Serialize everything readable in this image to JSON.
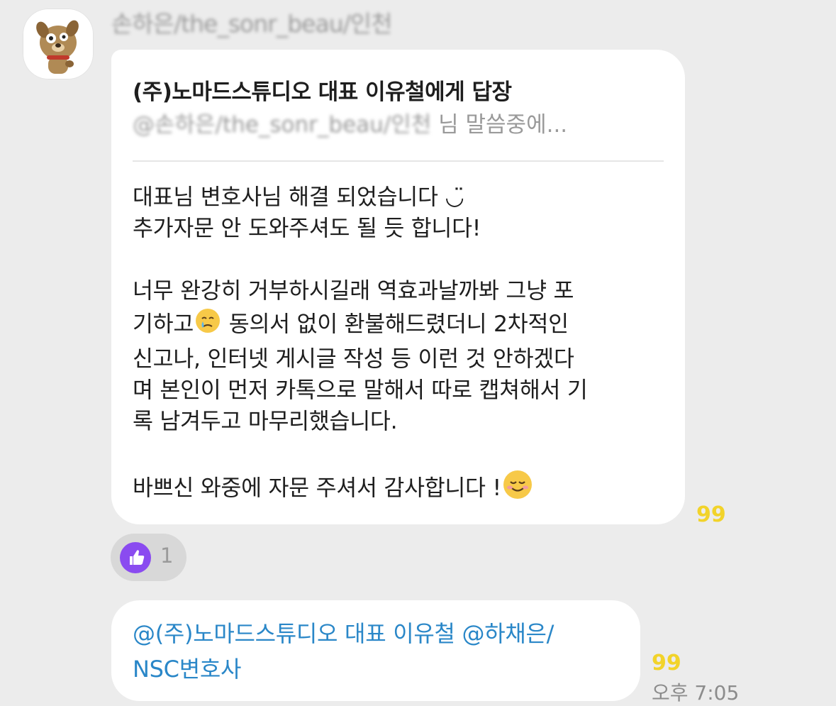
{
  "message1": {
    "sender_name": "손하은/the_sonr_beau/인천",
    "reply_header": {
      "title": "(주)노마드스튜디오 대표 이유철에게 답장",
      "quoted_user": "@손하은/the_sonr_beau/인천",
      "quoted_preview": "님 말씀중에..."
    },
    "lines": [
      "대표님 변호사님 해결 되었습니다 ◡̈",
      "추가자문 안 도와주셔도 될 듯 합니다!",
      "",
      "너무 완강히 거부하시길래 역효과날까봐 그냥 포",
      "기하고",
      " 동의서 없이 환불해드렸더니 2차적인",
      "신고나, 인터넷 게시글 작성 등 이런 것 안하겠다",
      "며 본인이 먼저 카톡으로 말해서 따로 캡쳐해서 기",
      "록 남겨두고 마무리했습니다.",
      "",
      "바쁘신 와중에 자문 주셔서 감사합니다 !"
    ],
    "unread_count": "99",
    "reaction": {
      "icon": "thumbs-up-icon",
      "count": "1",
      "color": "#8a4bf0"
    }
  },
  "message2": {
    "lines": [
      "@(주)노마드스튜디오 대표 이유철 @하채은/",
      "NSC변호사"
    ],
    "link_color": "#2a87c8",
    "unread_count": "99",
    "time": "오후 7:05"
  },
  "colors": {
    "background": "#ececec",
    "bubble": "#ffffff",
    "unread": "#f2d32a"
  }
}
